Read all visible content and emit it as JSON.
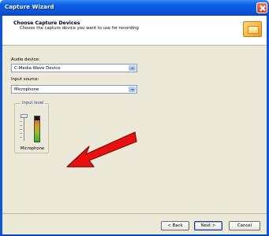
{
  "window": {
    "title": "Capture Wizard"
  },
  "header": {
    "title": "Choose Capture Devices",
    "subtitle": "Choose the capture device you want to use for recording"
  },
  "audio_device": {
    "label": "Audio device:",
    "value": "C-Media Wave Device"
  },
  "input_source": {
    "label": "Input source:",
    "value": "Microphone"
  },
  "input_level": {
    "legend": "Input level",
    "caption": "Microphone",
    "meter_level": 0.85
  },
  "annotation": {
    "arrow_color": "#e8110f"
  },
  "footer": {
    "back_label": "< Back",
    "next_label": "Next >",
    "cancel_label": "Cancel"
  },
  "colors": {
    "titlebar": "#0b5fe4",
    "dialog_background": "#ece9d8"
  }
}
